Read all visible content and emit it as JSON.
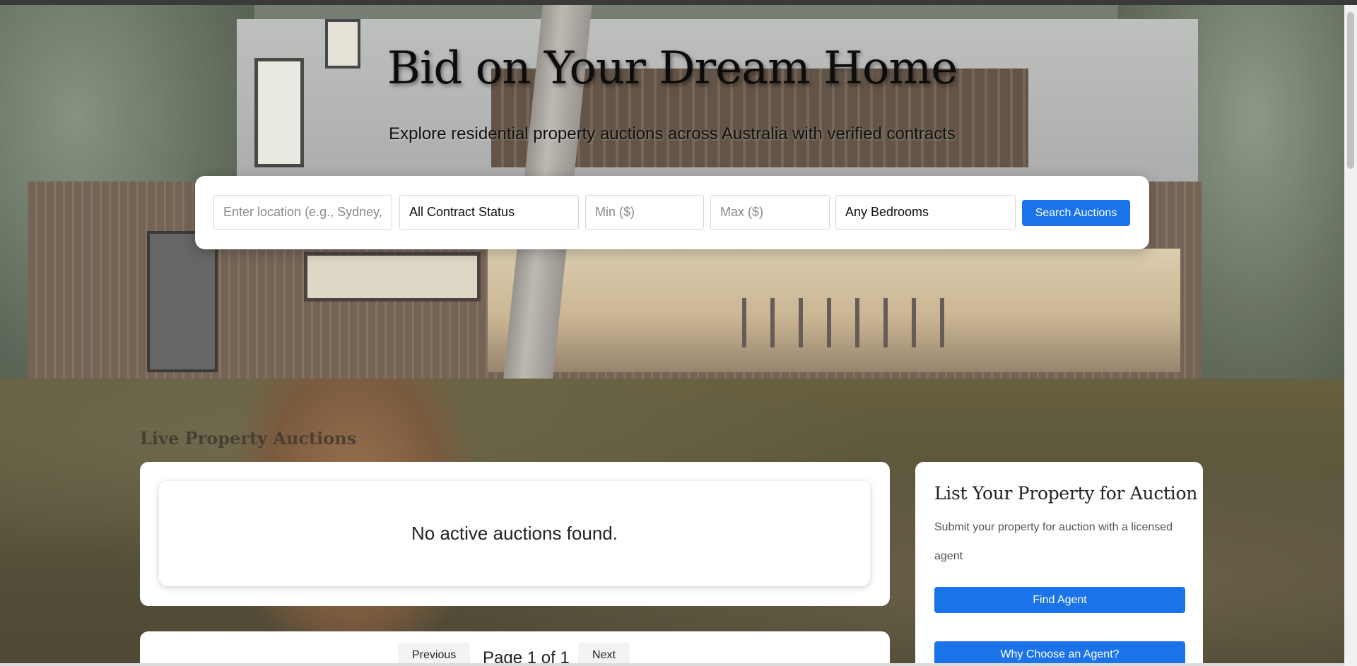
{
  "hero": {
    "title": "Bid on Your Dream Home",
    "subtitle": "Explore residential property auctions across Australia with verified contracts"
  },
  "search": {
    "location_placeholder": "Enter location (e.g., Sydney, Melbourne)",
    "contract_status_value": "All Contract Status",
    "min_placeholder": "Min ($)",
    "max_placeholder": "Max ($)",
    "bedrooms_value": "Any Bedrooms",
    "button_label": "Search Auctions"
  },
  "auctions": {
    "section_title": "Live Property Auctions",
    "empty_message": "No active auctions found."
  },
  "pagination": {
    "previous_label": "Previous",
    "page_label": "Page 1 of 1",
    "next_label": "Next"
  },
  "sidebar": {
    "title": "List Your Property for Auction",
    "description": "Submit your property for auction with a licensed agent",
    "find_agent_label": "Find Agent",
    "why_agent_label": "Why Choose an Agent?"
  },
  "colors": {
    "accent": "#1a73e8"
  }
}
